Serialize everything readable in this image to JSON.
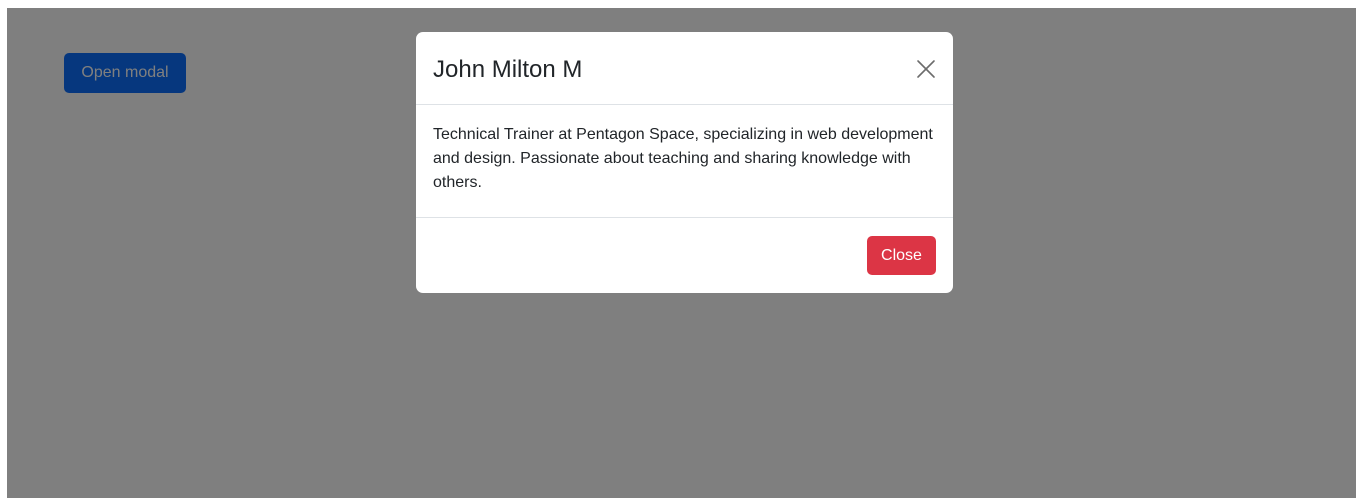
{
  "page": {
    "open_button_label": "Open modal"
  },
  "modal": {
    "title": "John Milton M",
    "body": "Technical Trainer at Pentagon Space, specializing in web development and design. Passionate about teaching and sharing knowledge with others.",
    "close_button_label": "Close",
    "close_icon": "close-icon"
  },
  "colors": {
    "primary": "#0d6efd",
    "danger": "#dc3545",
    "backdrop": "rgba(0,0,0,0.5)",
    "text": "#212529",
    "divider": "#dee2e6"
  }
}
